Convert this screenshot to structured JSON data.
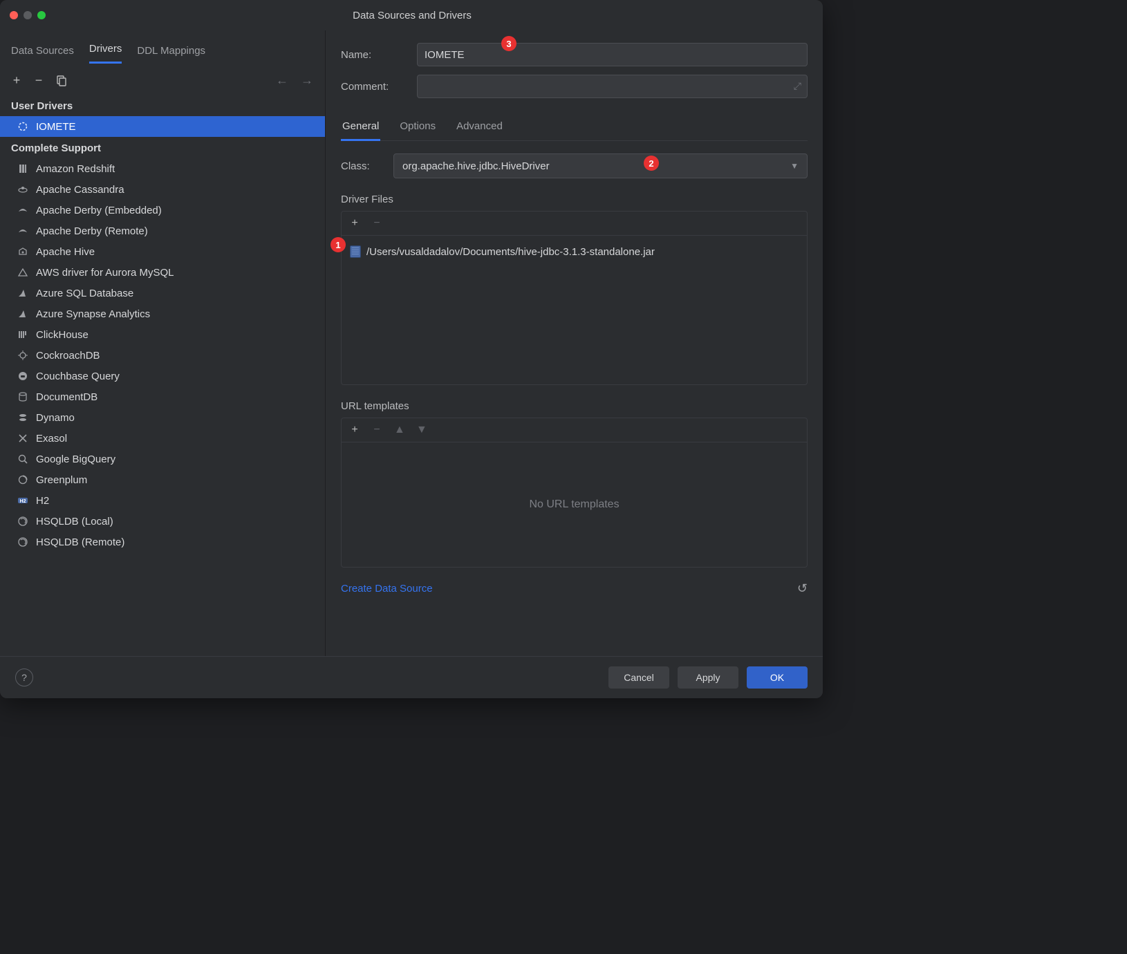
{
  "window": {
    "title": "Data Sources and Drivers"
  },
  "left": {
    "tabs": [
      "Data Sources",
      "Drivers",
      "DDL Mappings"
    ],
    "active_tab": "Drivers",
    "sections": {
      "user_drivers_title": "User Drivers",
      "user_drivers": [
        {
          "label": "IOMETE",
          "icon": "iomete"
        }
      ],
      "complete_title": "Complete Support",
      "complete": [
        {
          "label": "Amazon Redshift",
          "icon": "redshift"
        },
        {
          "label": "Apache Cassandra",
          "icon": "cassandra"
        },
        {
          "label": "Apache Derby (Embedded)",
          "icon": "derby"
        },
        {
          "label": "Apache Derby (Remote)",
          "icon": "derby"
        },
        {
          "label": "Apache Hive",
          "icon": "hive"
        },
        {
          "label": "AWS driver for Aurora MySQL",
          "icon": "aurora"
        },
        {
          "label": "Azure SQL Database",
          "icon": "azure"
        },
        {
          "label": "Azure Synapse Analytics",
          "icon": "azure"
        },
        {
          "label": "ClickHouse",
          "icon": "clickhouse"
        },
        {
          "label": "CockroachDB",
          "icon": "cockroach"
        },
        {
          "label": "Couchbase Query",
          "icon": "couchbase"
        },
        {
          "label": "DocumentDB",
          "icon": "documentdb"
        },
        {
          "label": "Dynamo",
          "icon": "dynamo"
        },
        {
          "label": "Exasol",
          "icon": "exasol"
        },
        {
          "label": "Google BigQuery",
          "icon": "bigquery"
        },
        {
          "label": "Greenplum",
          "icon": "greenplum"
        },
        {
          "label": "H2",
          "icon": "h2"
        },
        {
          "label": "HSQLDB (Local)",
          "icon": "hsqldb"
        },
        {
          "label": "HSQLDB (Remote)",
          "icon": "hsqldb"
        }
      ]
    }
  },
  "right": {
    "name_label": "Name:",
    "name_value": "IOMETE",
    "comment_label": "Comment:",
    "comment_value": "",
    "subtabs": [
      "General",
      "Options",
      "Advanced"
    ],
    "active_subtab": "General",
    "class_label": "Class:",
    "class_value": "org.apache.hive.jdbc.HiveDriver",
    "driver_files_label": "Driver Files",
    "driver_files": [
      "/Users/vusaldadalov/Documents/hive-jdbc-3.1.3-standalone.jar"
    ],
    "url_templates_label": "URL templates",
    "url_templates_empty": "No URL templates",
    "create_link": "Create Data Source"
  },
  "footer": {
    "cancel": "Cancel",
    "apply": "Apply",
    "ok": "OK"
  },
  "badges": {
    "one": "1",
    "two": "2",
    "three": "3"
  }
}
